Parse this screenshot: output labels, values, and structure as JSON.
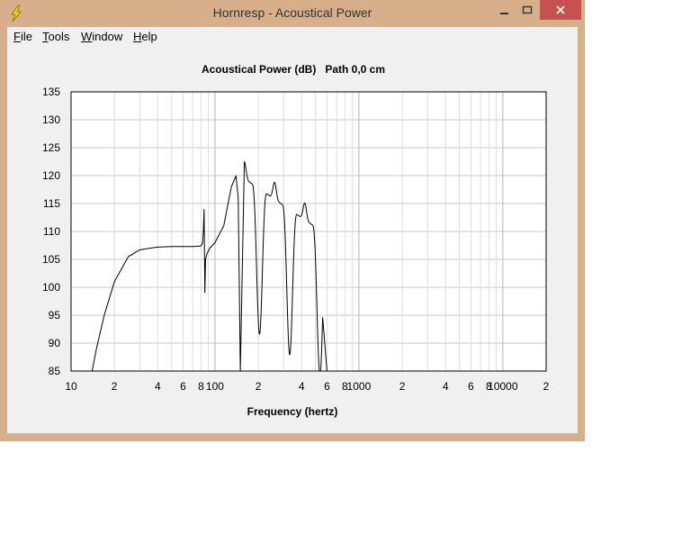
{
  "window": {
    "title": "Hornresp - Acoustical Power"
  },
  "menu": [
    {
      "accel": "F",
      "rest": "ile"
    },
    {
      "accel": "T",
      "rest": "ools"
    },
    {
      "accel": "W",
      "rest": "indow"
    },
    {
      "accel": "H",
      "rest": "elp"
    }
  ],
  "chart_data": {
    "type": "line",
    "title": "Acoustical Power (dB)   Path 0,0 cm",
    "xlabel": "Frequency (hertz)",
    "ylabel": "",
    "xscale": "log",
    "xlim": [
      10,
      20000
    ],
    "ylim": [
      85,
      135
    ],
    "grid": true,
    "y_ticks": [
      "135",
      "130",
      "125",
      "120",
      "115",
      "110",
      "105",
      "100",
      "95",
      "90",
      "85"
    ],
    "x_ticks": [
      "10",
      "2",
      "4",
      "6",
      "8",
      "100",
      "2",
      "4",
      "6",
      "8",
      "1000",
      "2",
      "4",
      "6",
      "8",
      "10000",
      "2"
    ],
    "series": [
      {
        "values_x": [
          14,
          15,
          17,
          20,
          25,
          30,
          35,
          40,
          50,
          60,
          70,
          80
        ],
        "values_y": [
          85,
          89,
          95,
          101,
          105.5,
          106.7,
          107,
          107.2,
          107.3,
          107.3,
          107.3,
          107.4
        ]
      },
      {
        "values_x": [
          82,
          83,
          84,
          85,
          86,
          88,
          92,
          100,
          115,
          130,
          140,
          145
        ],
        "values_y": [
          108,
          110,
          114,
          99,
          105,
          106,
          107,
          108,
          111,
          118,
          120,
          116
        ]
      }
    ]
  },
  "colors": {
    "curve": "#000000",
    "grid": "#c8c8c8",
    "frame": "#000000",
    "client": "#f0f0f0",
    "border": "#d7b08b",
    "close": "#c75050"
  }
}
